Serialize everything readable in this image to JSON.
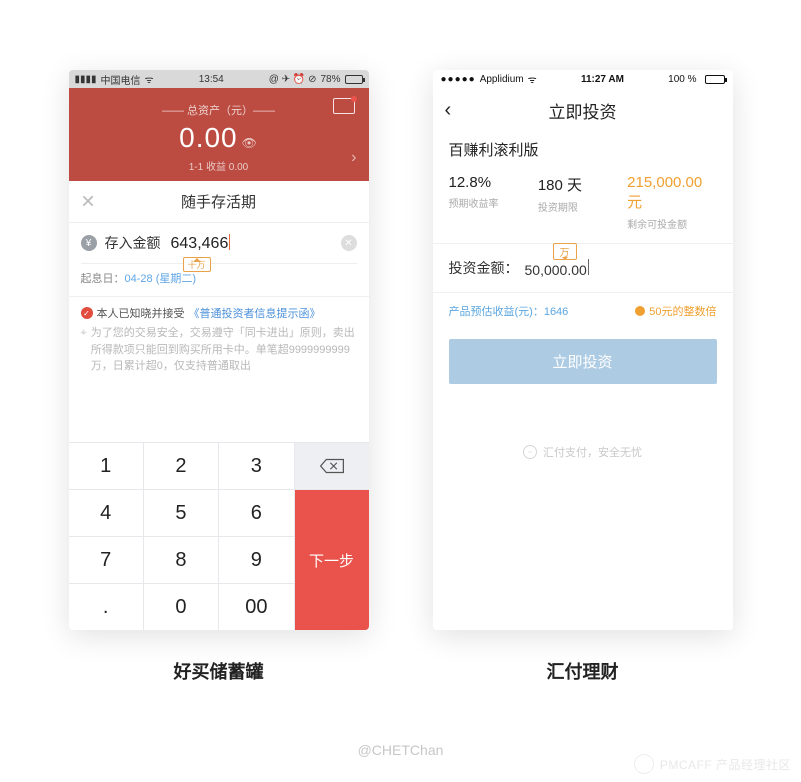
{
  "left": {
    "caption": "好买储蓄罐",
    "status": {
      "carrier": "中国电信",
      "time": "13:54",
      "battery_pct": "78%"
    },
    "red": {
      "label_top": "—— 总资产（元）——",
      "amount": "0.00",
      "label_bottom": "1-1 收益   0.00"
    },
    "sheet_title": "随手存活期",
    "amount_label": "存入金额",
    "amount_value": "643,466",
    "amount_tag": "十万",
    "start_date_label": "起息日：",
    "start_date_value": "04-28 (星期二)",
    "agree_prefix": "本人已知晓并接受",
    "agree_link": "《普通投资者信息提示函》",
    "note": "为了您的交易安全，交易遵守「同卡进出」原则，卖出所得款项只能回到购买所用卡中。单笔超9999999999万，日累计超0，仅支持普通取出",
    "keys": [
      "1",
      "2",
      "3",
      "4",
      "5",
      "6",
      "7",
      "8",
      "9",
      ".",
      "0",
      "00"
    ],
    "next": "下一步"
  },
  "right": {
    "caption": "汇付理财",
    "status": {
      "carrier": "Applidium",
      "time": "11:27 AM",
      "battery_pct": "100 %"
    },
    "nav_title": "立即投资",
    "product": "百赚利滚利版",
    "stats": [
      {
        "value": "12.8%",
        "label": "预期收益率"
      },
      {
        "value": "180 天",
        "label": "投资期限"
      },
      {
        "value": "215,000.00元",
        "label": "剩余可投金额"
      }
    ],
    "amt_label": "投资金额：",
    "amt_value": "50,000.00",
    "amt_tag": "万",
    "meta_left": "产品预估收益(元)：1646",
    "meta_right": "50元的整数倍",
    "cta": "立即投资",
    "footer": "汇付支付，安全无忧"
  },
  "credit": "@CHETChan",
  "watermark": "PMCAFF 产品经理社区"
}
